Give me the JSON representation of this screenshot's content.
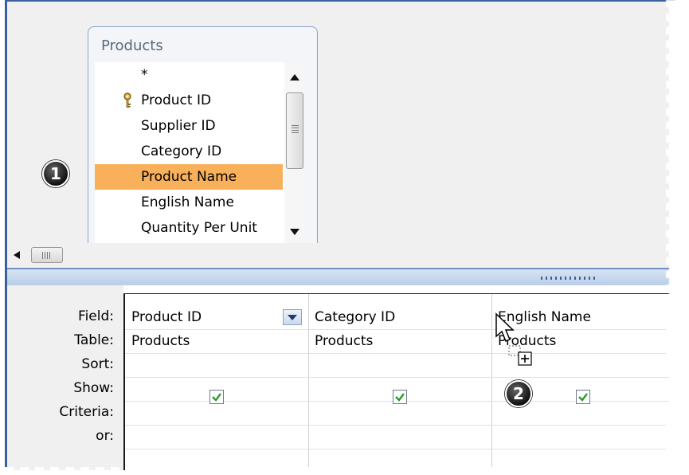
{
  "table": {
    "title": "Products",
    "fields": [
      "*",
      "Product ID",
      "Supplier ID",
      "Category ID",
      "Product Name",
      "English Name",
      "Quantity Per Unit"
    ],
    "selected_field": "Product Name",
    "key_field": "Product ID"
  },
  "callouts": {
    "one": "1",
    "two": "2"
  },
  "grid": {
    "row_labels": [
      "Field:",
      "Table:",
      "Sort:",
      "Show:",
      "Criteria:",
      "or:"
    ],
    "columns": [
      {
        "field": "Product ID",
        "table": "Products",
        "show": true
      },
      {
        "field": "Category ID",
        "table": "Products",
        "show": true
      },
      {
        "field": "English Name",
        "table": "Products",
        "show": true
      }
    ]
  },
  "colors": {
    "selection": "#f8b05a",
    "accent": "#3c5f9d",
    "check": "#2e9b2e"
  },
  "icons": [
    "key-icon",
    "scroll-up-arrow-icon",
    "scroll-down-arrow-icon",
    "scroll-left-arrow-icon",
    "dropdown-arrow-icon",
    "checkmark-icon",
    "mouse-cursor-icon",
    "drag-copy-icon"
  ]
}
